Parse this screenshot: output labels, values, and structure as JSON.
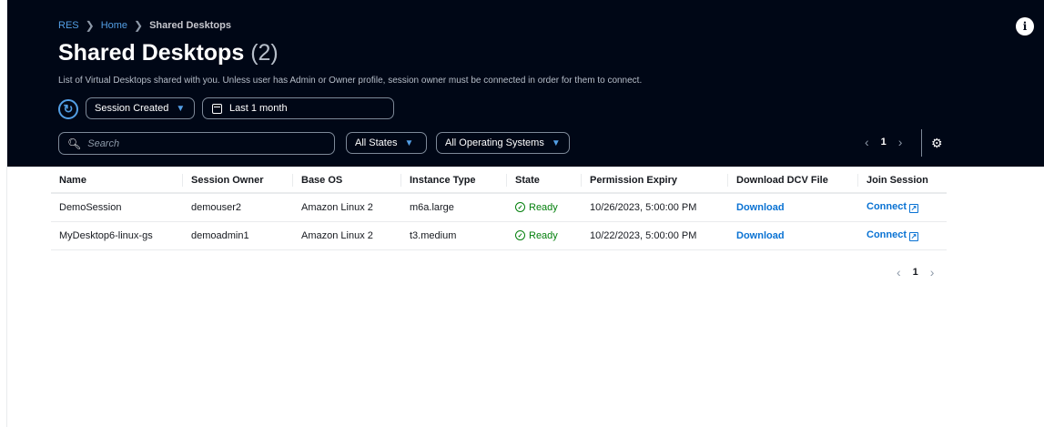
{
  "breadcrumb": {
    "root": "RES",
    "home": "Home",
    "current": "Shared Desktops"
  },
  "header": {
    "title": "Shared Desktops",
    "count": "(2)",
    "description": "List of Virtual Desktops shared with you. Unless user has Admin or Owner profile, session owner must be connected in order for them to connect."
  },
  "filters": {
    "date_field": "Session Created",
    "date_range": "Last 1 month",
    "search_placeholder": "Search",
    "states": "All States",
    "os": "All Operating Systems"
  },
  "pagination": {
    "current_page": "1"
  },
  "table": {
    "columns": [
      "Name",
      "Session Owner",
      "Base OS",
      "Instance Type",
      "State",
      "Permission Expiry",
      "Download DCV File",
      "Join Session"
    ],
    "rows": [
      {
        "name": "DemoSession",
        "owner": "demouser2",
        "os": "Amazon Linux 2",
        "instance": "m6a.large",
        "state": "Ready",
        "expiry": "10/26/2023, 5:00:00 PM",
        "download": "Download",
        "join": "Connect"
      },
      {
        "name": "MyDesktop6-linux-gs",
        "owner": "demoadmin1",
        "os": "Amazon Linux 2",
        "instance": "t3.medium",
        "state": "Ready",
        "expiry": "10/22/2023, 5:00:00 PM",
        "download": "Download",
        "join": "Connect"
      }
    ]
  },
  "colors": {
    "hero_bg": "#000716",
    "link": "#0972d3",
    "ready": "#037f0c"
  }
}
